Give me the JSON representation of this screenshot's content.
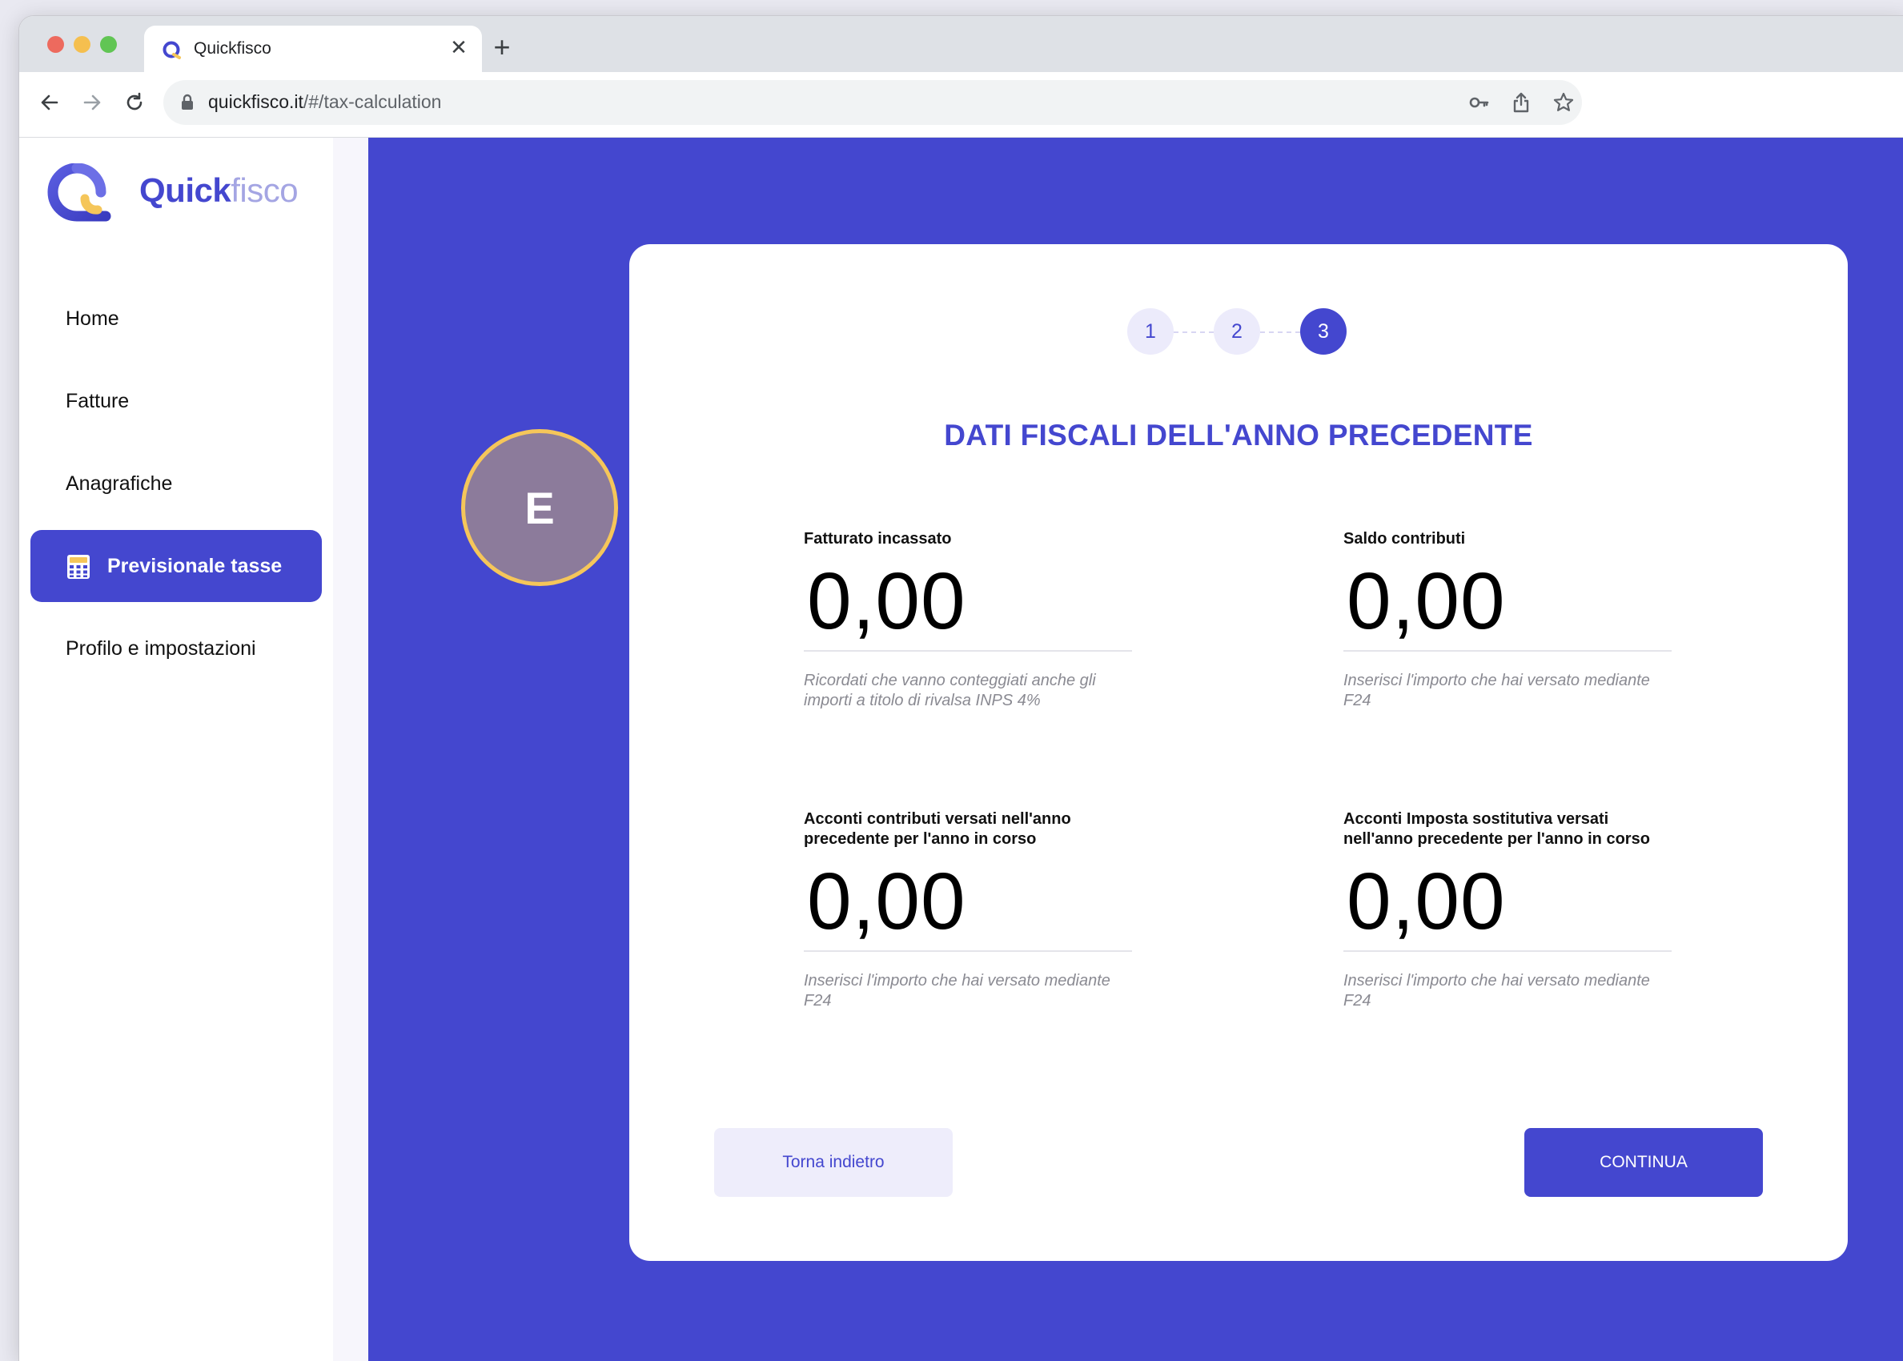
{
  "browser": {
    "tab_title": "Quickfisco",
    "url_host": "quickfisco.it",
    "url_path": "/#/tax-calculation"
  },
  "logo": {
    "part1": "Quick",
    "part2": "fisco"
  },
  "sidebar": {
    "items": [
      {
        "label": "Home"
      },
      {
        "label": "Fatture"
      },
      {
        "label": "Anagrafiche"
      },
      {
        "label": "Previsionale tasse",
        "active": true
      },
      {
        "label": "Profilo e impostazioni"
      }
    ]
  },
  "avatar": {
    "initial": "E"
  },
  "stepper": {
    "steps": [
      "1",
      "2",
      "3"
    ],
    "current": "3"
  },
  "form": {
    "title": "DATI FISCALI DELL'ANNO PRECEDENTE",
    "fields": [
      {
        "label": "Fatturato incassato",
        "value": "0,00",
        "hint": "Ricordati che vanno conteggiati anche gli importi a titolo di rivalsa INPS 4%"
      },
      {
        "label": "Saldo contributi",
        "value": "0,00",
        "hint": "Inserisci l'importo che hai versato mediante F24"
      },
      {
        "label": "Acconti contributi versati nell'anno precedente per l'anno in corso",
        "value": "0,00",
        "hint": "Inserisci l'importo che hai versato mediante F24"
      },
      {
        "label": "Acconti Imposta sostitutiva versati nell'anno precedente per l'anno in corso",
        "value": "0,00",
        "hint": "Inserisci l'importo che hai versato mediante F24"
      }
    ],
    "back_label": "Torna indietro",
    "continue_label": "CONTINUA"
  },
  "colors": {
    "brand": "#4447cf",
    "brand_light": "#a4a5e3",
    "avatar_bg": "#8c7b9b",
    "avatar_ring": "#f5c65a"
  },
  "icons": [
    "quickfisco-favicon",
    "close-icon",
    "plus-icon",
    "back-arrow-icon",
    "forward-arrow-icon",
    "reload-icon",
    "lock-icon",
    "key-icon",
    "share-icon",
    "star-icon",
    "calculator-icon"
  ]
}
